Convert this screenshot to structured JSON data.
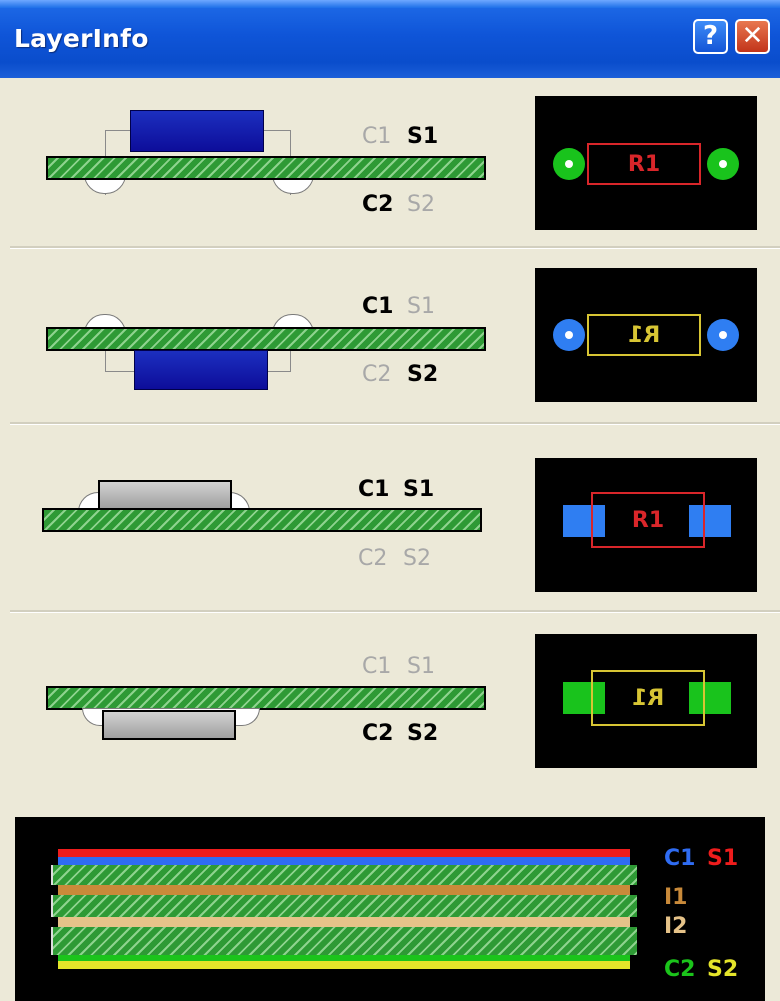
{
  "window": {
    "title": "LayerInfo"
  },
  "titlebar_buttons": {
    "help": "?",
    "close": "✕"
  },
  "panels": [
    {
      "id": "thru-hole-top",
      "row1": [
        "C1",
        "S1"
      ],
      "row2": [
        "C2",
        "S2"
      ],
      "active": [
        "S1",
        "C2"
      ],
      "component": "R1",
      "mirrored": false,
      "outline_color": "#d9262a",
      "pad_color": "#19c31c"
    },
    {
      "id": "thru-hole-bottom",
      "row1": [
        "C1",
        "S1"
      ],
      "row2": [
        "C2",
        "S2"
      ],
      "active": [
        "C1",
        "S2"
      ],
      "component": "R1",
      "mirrored": true,
      "outline_color": "#d7c534",
      "pad_color": "#2f7ef2"
    },
    {
      "id": "smd-top",
      "row1": [
        "C1",
        "S1"
      ],
      "row2": [
        "C2",
        "S2"
      ],
      "active": [
        "C1",
        "S1"
      ],
      "component": "R1",
      "mirrored": false,
      "outline_color": "#d9262a",
      "pad_color": "#2f7ef2"
    },
    {
      "id": "smd-bottom",
      "row1": [
        "C1",
        "S1"
      ],
      "row2": [
        "C2",
        "S2"
      ],
      "active": [
        "C2",
        "S2"
      ],
      "component": "R1",
      "mirrored": true,
      "outline_color": "#d7c534",
      "pad_color": "#19c31c"
    }
  ],
  "stackup": {
    "labels": {
      "top_copper": "C1",
      "top_silk": "S1",
      "inner1": "I1",
      "inner2": "I2",
      "bottom_copper": "C2",
      "bottom_silk": "S2"
    },
    "colors": {
      "top_silk": "#ee1c1c",
      "top_copper": "#2f6cf2",
      "inner1": "#c98a3a",
      "inner2": "#e6c389",
      "bottom_copper": "#1bc41b",
      "bottom_silk": "#e4e42a"
    }
  }
}
